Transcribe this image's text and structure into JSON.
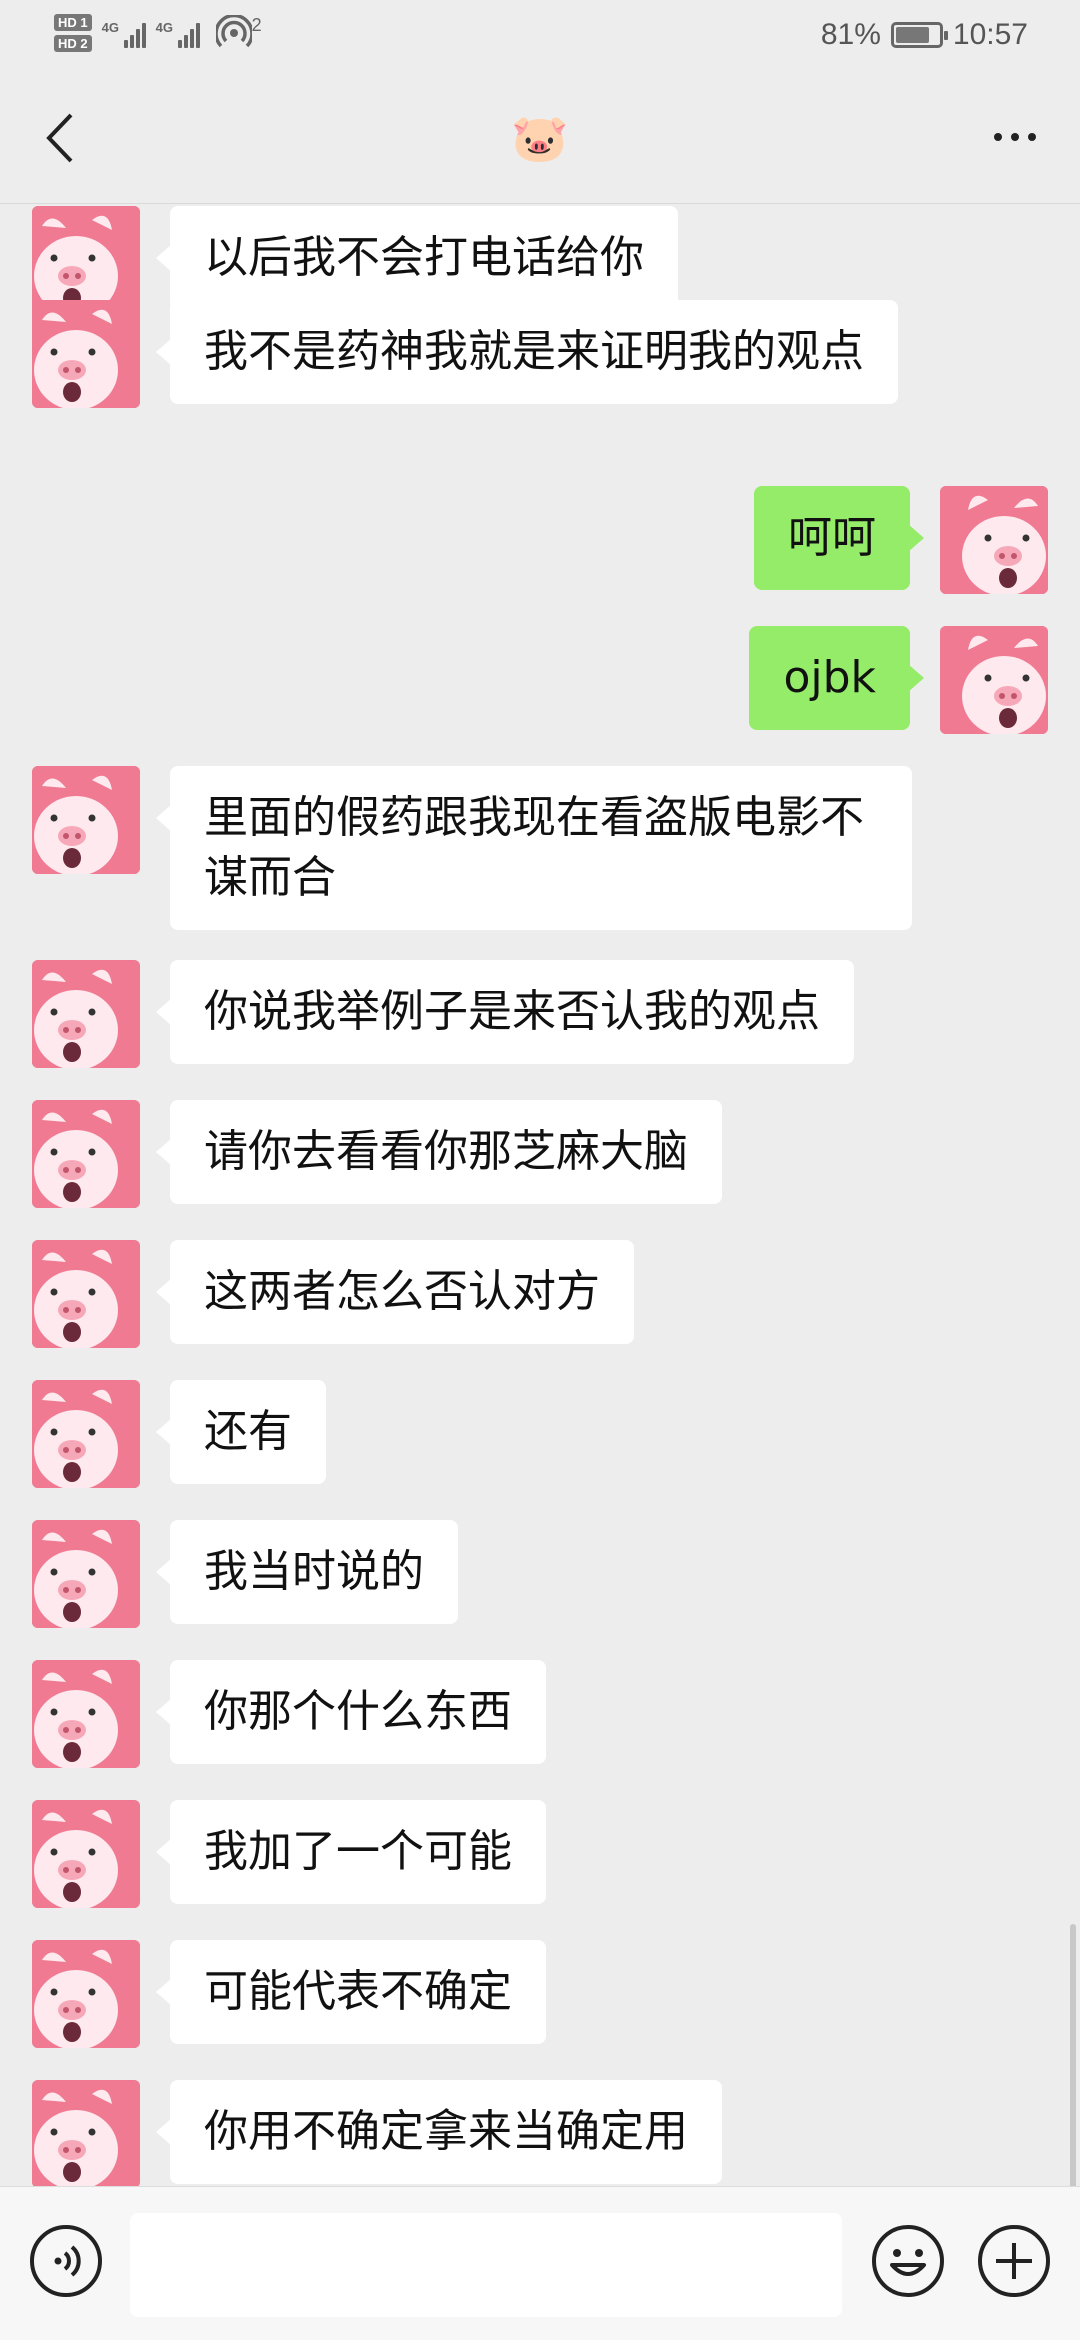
{
  "status_bar": {
    "hd1": "HD 1",
    "hd2": "HD 2",
    "net1": "4G",
    "net2": "4G",
    "hotspot_count": "2",
    "battery": "81%",
    "battery_level": 0.81,
    "time": "10:57"
  },
  "header": {
    "title": "🐷",
    "back_icon": "chevron-left-icon",
    "more_icon": "more-dots-icon"
  },
  "messages": [
    {
      "side": "left",
      "text": "以后我不会打电话给你"
    },
    {
      "side": "left",
      "text": "我不是药神我就是来证明我的观点"
    },
    {
      "side": "right",
      "text": "呵呵"
    },
    {
      "side": "right",
      "text": "ojbk"
    },
    {
      "side": "left",
      "text": "里面的假药跟我现在看盗版电影不谋而合"
    },
    {
      "side": "left",
      "text": "你说我举例子是来否认我的观点"
    },
    {
      "side": "left",
      "text": "请你去看看你那芝麻大脑"
    },
    {
      "side": "left",
      "text": "这两者怎么否认对方"
    },
    {
      "side": "left",
      "text": "还有"
    },
    {
      "side": "left",
      "text": "我当时说的"
    },
    {
      "side": "left",
      "text": "你那个什么东西"
    },
    {
      "side": "left",
      "text": "我加了一个可能"
    },
    {
      "side": "left",
      "text": "可能代表不确定"
    },
    {
      "side": "left",
      "text": "你用不确定拿来当确定用"
    }
  ],
  "input_bar": {
    "message_value": "",
    "voice_icon": "voice-icon",
    "emoji_icon": "emoji-icon",
    "plus_icon": "plus-icon"
  },
  "colors": {
    "background": "#ededed",
    "outgoing_bubble": "#95ec69",
    "incoming_bubble": "#ffffff",
    "avatar_pink": "#f07a92"
  }
}
